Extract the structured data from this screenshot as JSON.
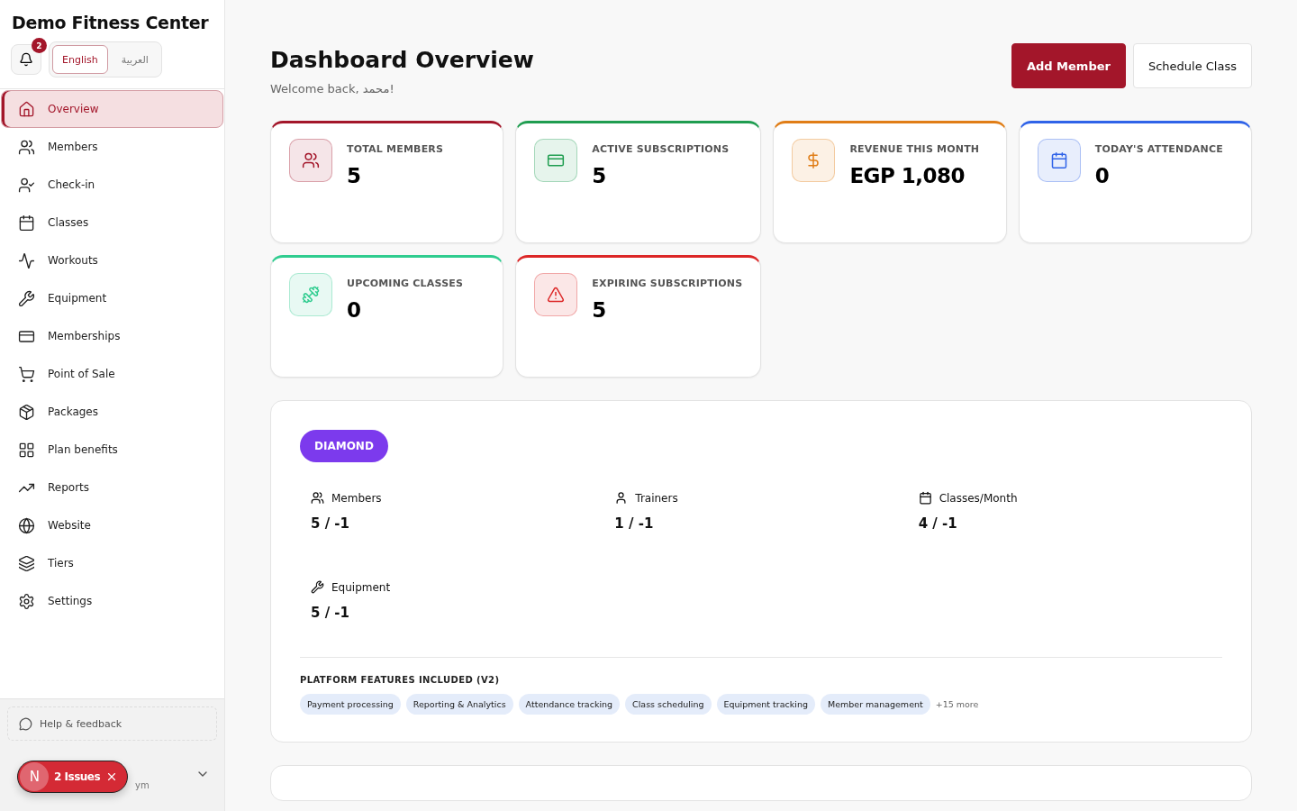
{
  "sidebar": {
    "title": "Demo Fitness Center",
    "notifications": {
      "count": "2"
    },
    "languages": [
      {
        "label": "English",
        "selected": true
      },
      {
        "label": "العربية",
        "selected": false
      }
    ],
    "items": [
      {
        "label": "Overview",
        "selected": true
      },
      {
        "label": "Members",
        "selected": false
      },
      {
        "label": "Check-in",
        "selected": false
      },
      {
        "label": "Classes",
        "selected": false
      },
      {
        "label": "Workouts",
        "selected": false
      },
      {
        "label": "Equipment",
        "selected": false
      },
      {
        "label": "Memberships",
        "selected": false
      },
      {
        "label": "Point of Sale",
        "selected": false
      },
      {
        "label": "Packages",
        "selected": false
      },
      {
        "label": "Plan benefits",
        "selected": false
      },
      {
        "label": "Reports",
        "selected": false
      },
      {
        "label": "Website",
        "selected": false
      },
      {
        "label": "Tiers",
        "selected": false
      },
      {
        "label": "Settings",
        "selected": false
      }
    ],
    "help": "Help & feedback",
    "user_subtitle": "ym",
    "issues": {
      "avatar": "N",
      "label": "2 Issues"
    }
  },
  "header": {
    "title": "Dashboard Overview",
    "subtitle": "Welcome back, محمد!",
    "buttons": [
      {
        "label": "Add Member",
        "kind": "primary"
      },
      {
        "label": "Schedule Class",
        "kind": "secondary"
      }
    ]
  },
  "stats": [
    {
      "label": "TOTAL MEMBERS",
      "value": "5",
      "color": "#a3162a"
    },
    {
      "label": "ACTIVE SUBSCRIPTIONS",
      "value": "5",
      "color": "#1f9d50"
    },
    {
      "label": "REVENUE THIS MONTH",
      "value": "EGP 1,080",
      "color": "#e07d16"
    },
    {
      "label": "TODAY'S ATTENDANCE",
      "value": "0",
      "color": "#2f63e8"
    },
    {
      "label": "UPCOMING CLASSES",
      "value": "0",
      "color": "#2fcc8f"
    },
    {
      "label": "EXPIRING SUBSCRIPTIONS",
      "value": "5",
      "color": "#dc2626"
    }
  ],
  "plan": {
    "tier": "DIAMOND",
    "limits": [
      {
        "label": "Members",
        "value": "5 / -1"
      },
      {
        "label": "Trainers",
        "value": "1 / -1"
      },
      {
        "label": "Classes/Month",
        "value": "4 / -1"
      },
      {
        "label": "Equipment",
        "value": "5 / -1"
      }
    ],
    "features_title": "PLATFORM FEATURES INCLUDED (V2)",
    "features": [
      "Payment processing",
      "Reporting & Analytics",
      "Attendance tracking",
      "Class scheduling",
      "Equipment tracking",
      "Member management"
    ],
    "more": "+15 more"
  }
}
